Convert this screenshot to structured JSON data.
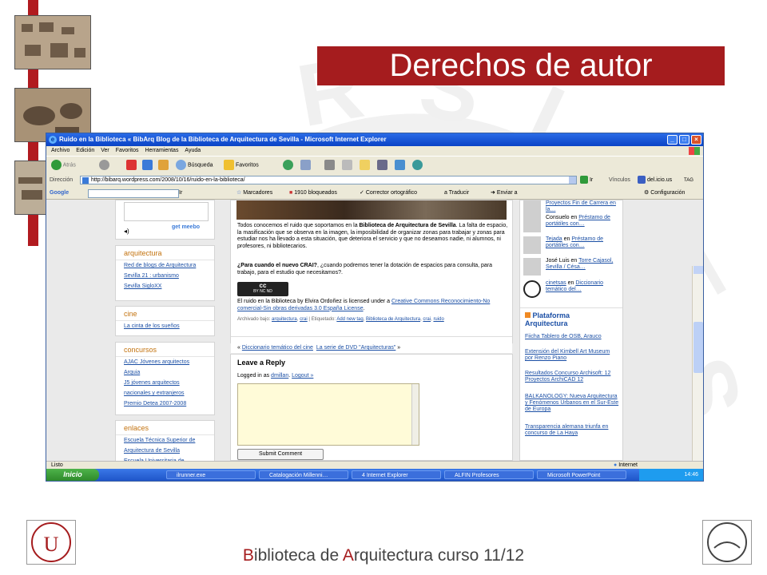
{
  "slide": {
    "title": "Derechos de autor",
    "footer_b1": "B",
    "footer_t1": "iblioteca de ",
    "footer_b2": "A",
    "footer_t2": "rquitectura curso 11/12"
  },
  "browser": {
    "window_title": "Ruido en la Biblioteca « BibArq Blog de la Biblioteca de Arquitectura de Sevilla - Microsoft Internet Explorer",
    "menu": [
      "Archivo",
      "Edición",
      "Ver",
      "Favoritos",
      "Herramientas",
      "Ayuda"
    ],
    "toolbar": {
      "back": "Atrás",
      "search": "Búsqueda",
      "favorites": "Favoritos"
    },
    "address_label": "Dirección",
    "url": "http://bibarq.wordpress.com/2008/10/16/ruido-en-la-biblioteca/",
    "go": "Ir",
    "links": "Vínculos",
    "delicious": "del.icio.us",
    "tag": "TAG",
    "google_bar": {
      "logo": "Google",
      "go": "Ir",
      "bookmarks": "Marcadores",
      "blocked": "1910 bloqueados",
      "spell": "Corrector ortográfico",
      "translate": "Traducir",
      "send": "Enviar a",
      "settings": "Configuración"
    },
    "status": "Listo",
    "zone": "Internet"
  },
  "blog": {
    "meebo": "get meebo",
    "sections": [
      {
        "title": "arquitectura",
        "items": [
          "Red de blogs de Arquitectura",
          "Sevilla 21 : urbanismo",
          "Sevilla SigloXX"
        ]
      },
      {
        "title": "cine",
        "items": [
          "La cinta de los sueños"
        ]
      },
      {
        "title": "concursos",
        "items": [
          "AJAC Jóvenes arquitectos",
          "Arquia",
          "J5 jóvenes arquitectos",
          "nacionales y extranjeros",
          "Premio Detea 2007-2008"
        ]
      },
      {
        "title": "enlaces",
        "items": [
          "Escuela Técnica Superior de",
          "Arquitectura de Sevilla",
          "Escuela Universitaria de"
        ]
      }
    ],
    "post": {
      "p1_a": "Todos conocemos el ruido que soportamos en la ",
      "p1_b": "Biblioteca de Arquitectura de Sevilla",
      "p1_c": ". La falta de espacio, la masificación que se observa en la imagen, la imposibilidad de organizar zonas para trabajar y zonas para estudiar nos ha llevado a esta situación, que deteriora el servicio y que no deseamos nadie, ni alumnos, ni profesores, ni bibliotecarios.",
      "p2_a": "¿Para cuando el nuevo CRAI?",
      "p2_b": ", ¿cuando podremos tener la dotación de espacios para consulta, para trabajo, para el estudio que necesitamos?.",
      "license_a": "El ruido en la Biblioteca by Elvira Ordoñez is licensed under a ",
      "license_link": "Creative Commons Reconocimiento-No comercial-Sin obras derivadas 3.0 España License",
      "license_end": ".",
      "archived": "Archivado bajo: ",
      "cat1": "arquitectura",
      "cat2": "crai",
      "tags_label": " | Etiquetado: ",
      "tag_new": "Add new tag",
      "tag_bib": "Biblioteca de Arquitectura",
      "tag_crai": "crai",
      "tag_ruido": "ruido",
      "prev_link": "Diccionario temático del cine",
      "next_link": "La serie de DVD \"Arquitecturas\"",
      "cc_badge": "cc",
      "cc_small": "BY  NC  ND"
    },
    "reply": {
      "title": "Leave a Reply",
      "logged": "Logged in as ",
      "user": "dmillan",
      "logout": "Logout »",
      "submit": "Submit Comment"
    },
    "comments": [
      {
        "who": "",
        "link": "Proyectos Fin de Carrera en la…"
      },
      {
        "who": "Consuelo",
        "link": "Préstamo de portátiles con…"
      },
      {
        "who": "Tejada",
        "link": "Préstamo de portátiles con…"
      },
      {
        "who": "José Luis",
        "link": "Torre Cajasol, Sevilla / Césa…"
      },
      {
        "who": "cinetsas",
        "link": "Diccionario temático del…"
      }
    ],
    "platform": {
      "title": "Plataforma Arquitectura",
      "items": [
        "Fiicha Tablero de OSB, Arauco",
        "Extensión del Kimbell Art Museum por Renzo Piano",
        "Resultados Concurso Archisoft: 12 Proyectos ArchiCAD 12",
        "BALKANOLOGY: Nueva Arquitectura y Fenómenos Urbanos en el Sur-Este de Europa",
        "Transparencia alemana triunfa en concurso de La Haya"
      ]
    }
  },
  "taskbar": {
    "start": "Inicio",
    "tasks": [
      "ilrunner.exe",
      "Catalogación Millenni…",
      "4 Internet Explorer",
      "ALFIN Profesores",
      "Microsoft PowerPoint"
    ],
    "clock": "14:46"
  },
  "colors": {
    "accent": "#a51c1e",
    "link": "#1b4fa5",
    "heading": "#c3720e"
  }
}
